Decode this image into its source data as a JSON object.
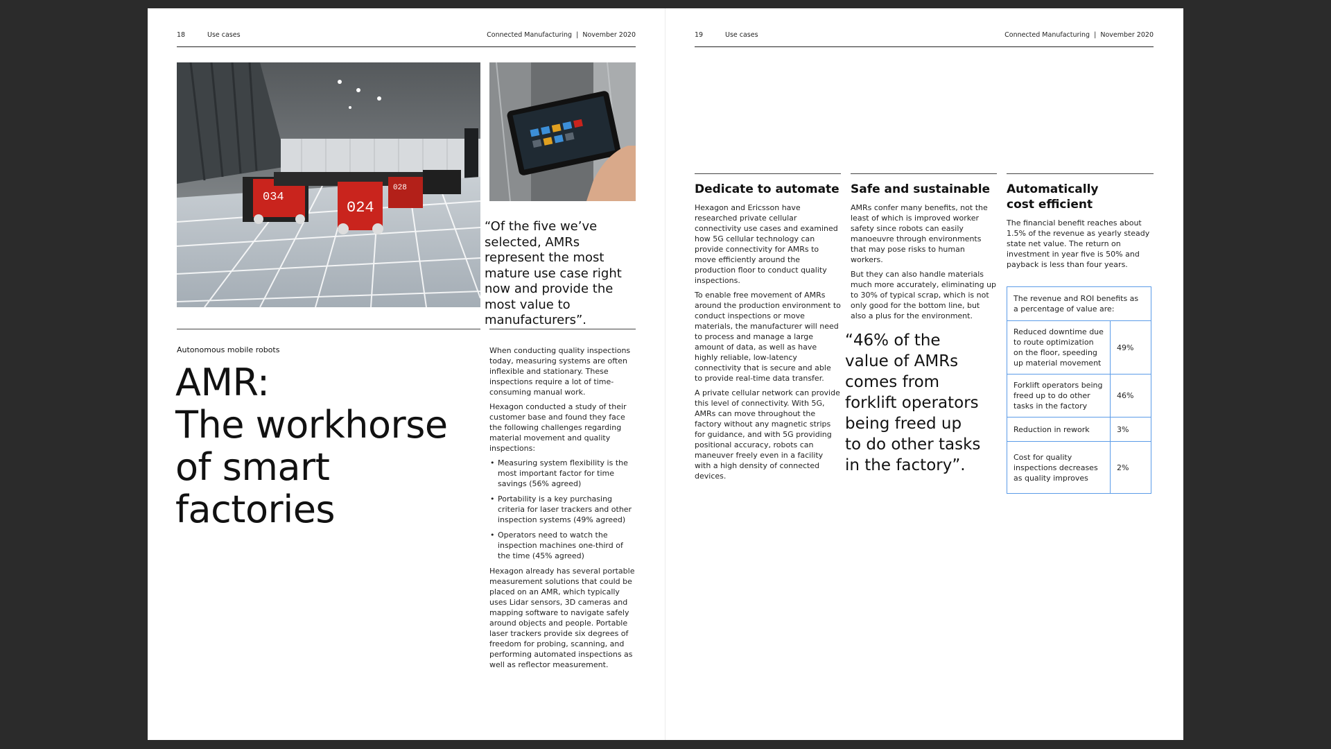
{
  "left_page": {
    "page_number": "18",
    "section": "Use cases",
    "publication": "Connected Manufacturing  |  November 2020",
    "kicker": "Autonomous mobile robots",
    "title_line1": "AMR:",
    "title_line2": "The workhorse",
    "title_line3": "of smart factories",
    "robot_labels": [
      "034",
      "024",
      "028"
    ],
    "quote": "“Of the five we’ve selected, AMRs represent the most mature use case right now and provide the most value to manufacturers”.",
    "body_intro": "When conducting quality inspections today, measuring systems are often inflexible and stationary. These inspections require a lot of time-consuming manual work.",
    "body_study": "Hexagon conducted a study of their customer base and found they face the following challenges regarding material movement and quality inspections:",
    "bullets": [
      "Measuring system flexibility is the most important factor for time savings (56% agreed)",
      "Portability is a key purchasing criteria for laser trackers and other inspection systems (49% agreed)",
      "Operators need to watch the inspection machines one-third of the time (45% agreed)"
    ],
    "body_outro": "Hexagon already has several portable measurement solutions that could be placed on an AMR, which typically uses Lidar sensors, 3D cameras and mapping software to navigate safely around objects and people. Portable laser trackers provide six degrees of freedom for probing, scanning, and performing automated inspections as well as reflector measurement."
  },
  "right_page": {
    "page_number": "19",
    "section": "Use cases",
    "publication": "Connected Manufacturing  |  November 2020",
    "col1": {
      "heading": "Dedicate to automate",
      "p1": "Hexagon and Ericsson have researched private cellular connectivity use cases and examined how 5G cellular technology can provide connectivity for AMRs to move efficiently around the production floor to conduct quality inspections.",
      "p2": "To enable free movement of AMRs around the production environment to conduct inspections or move materials, the manufacturer will need to process and manage a large amount of data, as well as have highly reliable, low-latency connectivity that is secure and able to provide real-time data transfer.",
      "p3": "A private cellular network can provide this level of connectivity. With 5G, AMRs can move throughout the factory without any magnetic strips for guidance, and with 5G providing positional accuracy, robots can maneuver freely even in a facility with a high density of connected devices."
    },
    "col2": {
      "heading": "Safe and sustainable",
      "p1": "AMRs confer many benefits, not the least of which is improved worker safety since robots can easily manoeuvre through environments that may pose risks to human workers.",
      "p2": "But they can also handle materials much more accurately, eliminating up to 30% of typical scrap, which is not only good for the bottom line, but also a plus for the environment.",
      "quote": "“46% of the value of AMRs comes from forklift operators being freed up to do other tasks in the factory”."
    },
    "col3": {
      "heading": "Automatically cost efficient",
      "p1": "The financial benefit reaches about 1.5% of the revenue as yearly steady state net value. The return on investment in year five is 50% and payback is less than four years.",
      "table_header": "The revenue and ROI benefits as a percentage of value are:",
      "rows": [
        {
          "label": "Reduced downtime due to route optimization on the floor, speeding up material movement",
          "value": "49%"
        },
        {
          "label": "Forklift operators being freed up to do other tasks in the factory",
          "value": "46%"
        },
        {
          "label": "Reduction in rework",
          "value": "3%"
        },
        {
          "label": "Cost for quality inspections decreases as quality improves",
          "value": "2%"
        }
      ]
    }
  },
  "colors": {
    "background": "#2b2b2b",
    "page": "#ffffff",
    "table_border": "#5b9be8",
    "robot_red": "#c9241d"
  }
}
